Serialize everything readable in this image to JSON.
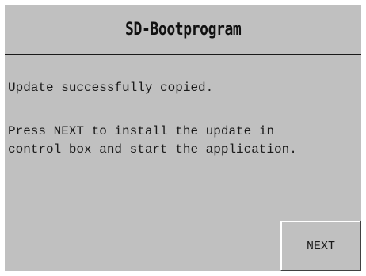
{
  "window": {
    "title": "SD-Bootprogram"
  },
  "message": {
    "line1": "Update successfully copied.",
    "line2": "Press NEXT to install the update in",
    "line3": "control box and start the application."
  },
  "actions": {
    "next_label": "NEXT"
  },
  "colors": {
    "background": "#c0c0c0",
    "text": "#1a1a1a",
    "frame": "#ffffff",
    "divider": "#1a1a1a"
  }
}
